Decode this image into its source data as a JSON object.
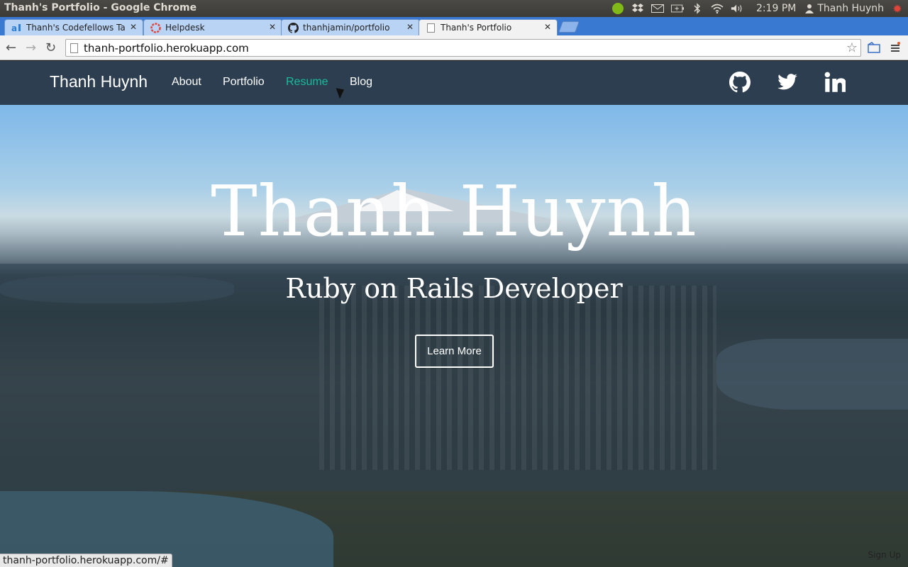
{
  "os": {
    "window_title": "Thanh's Portfolio - Google Chrome",
    "clock": "2:19 PM",
    "user_name": "Thanh Huynh",
    "tray_icons": [
      "spotify-icon",
      "dropbox-icon",
      "mail-icon",
      "battery-icon",
      "bluetooth-icon",
      "wifi-icon",
      "volume-icon",
      "user-icon",
      "system-gear-icon"
    ]
  },
  "browser": {
    "tabs": [
      {
        "label": "Thanh's Codefellows Task",
        "icon": "asana-icon"
      },
      {
        "label": "Helpdesk",
        "icon": "helpdesk-icon"
      },
      {
        "label": "thanhjamin/portfolio",
        "icon": "github-icon"
      },
      {
        "label": "Thanh's Portfolio",
        "icon": "page-icon"
      }
    ],
    "url": "thanh-portfolio.herokuapp.com",
    "status_url": "thanh-portfolio.herokuapp.com/#"
  },
  "site": {
    "brand": "Thanh Huynh",
    "nav": {
      "about": "About",
      "portfolio": "Portfolio",
      "resume": "Resume",
      "blog": "Blog"
    },
    "social": [
      "github-icon",
      "twitter-icon",
      "linkedin-icon"
    ],
    "hero": {
      "title": "Thanh Huynh",
      "subtitle": "Ruby on Rails Developer",
      "button": "Learn More"
    },
    "corner_text": "Sign Up"
  },
  "colors": {
    "nav_bg": "#2c3e50",
    "accent": "#18bc9c"
  }
}
